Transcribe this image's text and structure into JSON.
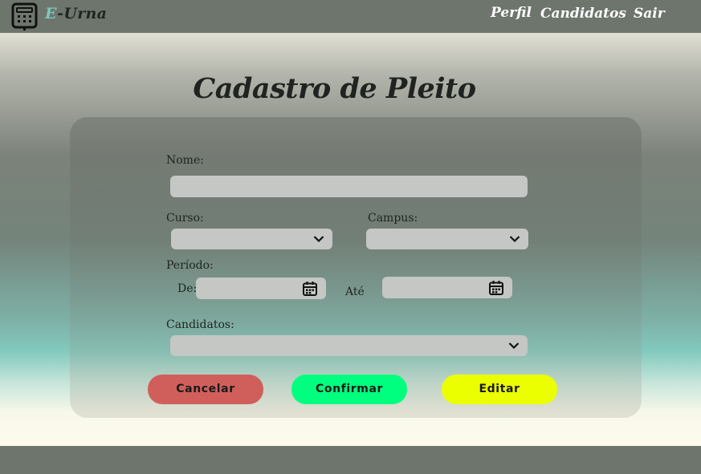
{
  "header": {
    "brand_first": "E",
    "brand_rest": "-Urna",
    "nav": {
      "perfil": "Perfil",
      "candidatos": "Candidatos",
      "sair": "Sair"
    }
  },
  "page": {
    "title": "Cadastro de Pleito"
  },
  "form": {
    "nome_label": "Nome:",
    "nome_value": "",
    "curso_label": "Curso:",
    "curso_value": "",
    "campus_label": "Campus:",
    "campus_value": "",
    "periodo_label": "Período:",
    "de_label": "De:",
    "de_value": "",
    "ate_label": "Até",
    "ate_value": "",
    "candidatos_label": "Candidatos:",
    "candidatos_value": ""
  },
  "buttons": {
    "cancelar": "Cancelar",
    "confirmar": "Confirmar",
    "editar": "Editar"
  },
  "colors": {
    "header_bg": "#6e756d",
    "brand_accent": "#7cc9bd",
    "cancel": "#d05f5c",
    "confirm": "#00ff7e",
    "edit": "#ecff00",
    "field_bg": "#c4c7c3"
  },
  "icons": {
    "logo": "ballot-box-icon",
    "select": "chevron-down-icon",
    "date": "calendar-icon"
  }
}
